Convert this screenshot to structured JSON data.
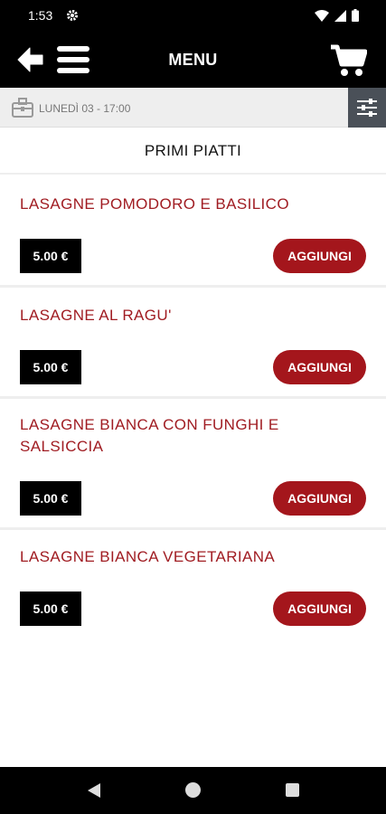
{
  "status_bar": {
    "time": "1:53"
  },
  "app_bar": {
    "title": "MENU"
  },
  "date_bar": {
    "label": "LUNEDÌ 03 - 17:00"
  },
  "section": {
    "title": "PRIMI PIATTI"
  },
  "products": [
    {
      "name": "LASAGNE POMODORO E BASILICO",
      "price": "5.00 €",
      "button": "AGGIUNGI"
    },
    {
      "name": "LASAGNE AL RAGU'",
      "price": "5.00 €",
      "button": "AGGIUNGI"
    },
    {
      "name": "LASAGNE BIANCA CON FUNGHI E SALSICCIA",
      "price": "5.00 €",
      "button": "AGGIUNGI"
    },
    {
      "name": "LASAGNE BIANCA VEGETARIANA",
      "price": "5.00 €",
      "button": "AGGIUNGI"
    }
  ],
  "colors": {
    "accent": "#a4161c",
    "title_red": "#a01c22",
    "bar": "#000000"
  }
}
